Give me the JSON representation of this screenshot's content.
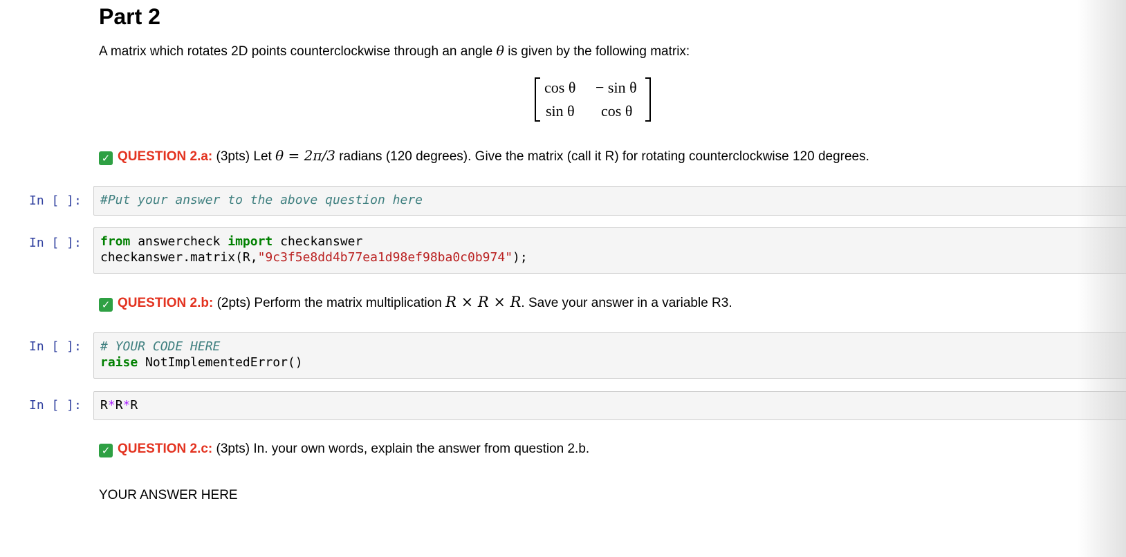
{
  "part": {
    "title": "Part 2"
  },
  "intro": {
    "text_before": "A matrix which rotates 2D points counterclockwise through an angle",
    "theta": "θ",
    "text_after": "is given by the following matrix:"
  },
  "matrix": {
    "r1c1": "cos θ",
    "r1c2": "− sin θ",
    "r2c1": "sin θ",
    "r2c2": "cos θ"
  },
  "questions": [
    {
      "label": "QUESTION 2.a:",
      "pts": "(3pts) Let",
      "math": "θ = 2π/3",
      "rest": "radians (120 degrees). Give the matrix (call it R) for rotating counterclockwise 120 degrees."
    },
    {
      "label": "QUESTION 2.b:",
      "pts": "(2pts) Perform the matrix multiplication",
      "math": "R × R × R",
      "rest": ". Save your answer in a variable R3."
    },
    {
      "label": "QUESTION 2.c:",
      "pts": "(3pts) In. your own words, explain the answer from question 2.b.",
      "math": "",
      "rest": ""
    }
  ],
  "cells": [
    {
      "prompt": "In [ ]:",
      "lines": [
        [
          {
            "cls": "comment",
            "t": "#Put your answer to the above question here"
          }
        ]
      ]
    },
    {
      "prompt": "In [ ]:",
      "lines": [
        [
          {
            "cls": "kw",
            "t": "from"
          },
          {
            "cls": "",
            "t": " answercheck "
          },
          {
            "cls": "kw",
            "t": "import"
          },
          {
            "cls": "",
            "t": " checkanswer"
          }
        ],
        [
          {
            "cls": "",
            "t": "checkanswer.matrix(R,"
          },
          {
            "cls": "str",
            "t": "\"9c3f5e8dd4b77ea1d98ef98ba0c0b974\""
          },
          {
            "cls": "",
            "t": ");"
          }
        ]
      ]
    },
    {
      "prompt": "In [ ]:",
      "lines": [
        [
          {
            "cls": "comment",
            "t": "# YOUR CODE HERE"
          }
        ],
        [
          {
            "cls": "kw",
            "t": "raise"
          },
          {
            "cls": "",
            "t": " NotImplementedError()"
          }
        ]
      ]
    },
    {
      "prompt": "In [ ]:",
      "lines": [
        [
          {
            "cls": "",
            "t": "R"
          },
          {
            "cls": "op",
            "t": "*"
          },
          {
            "cls": "",
            "t": "R"
          },
          {
            "cls": "op",
            "t": "*"
          },
          {
            "cls": "",
            "t": "R"
          }
        ]
      ]
    }
  ],
  "answer": {
    "text": "YOUR ANSWER HERE"
  },
  "icons": {
    "check": "check-mark-icon",
    "check_glyph": "✓"
  }
}
